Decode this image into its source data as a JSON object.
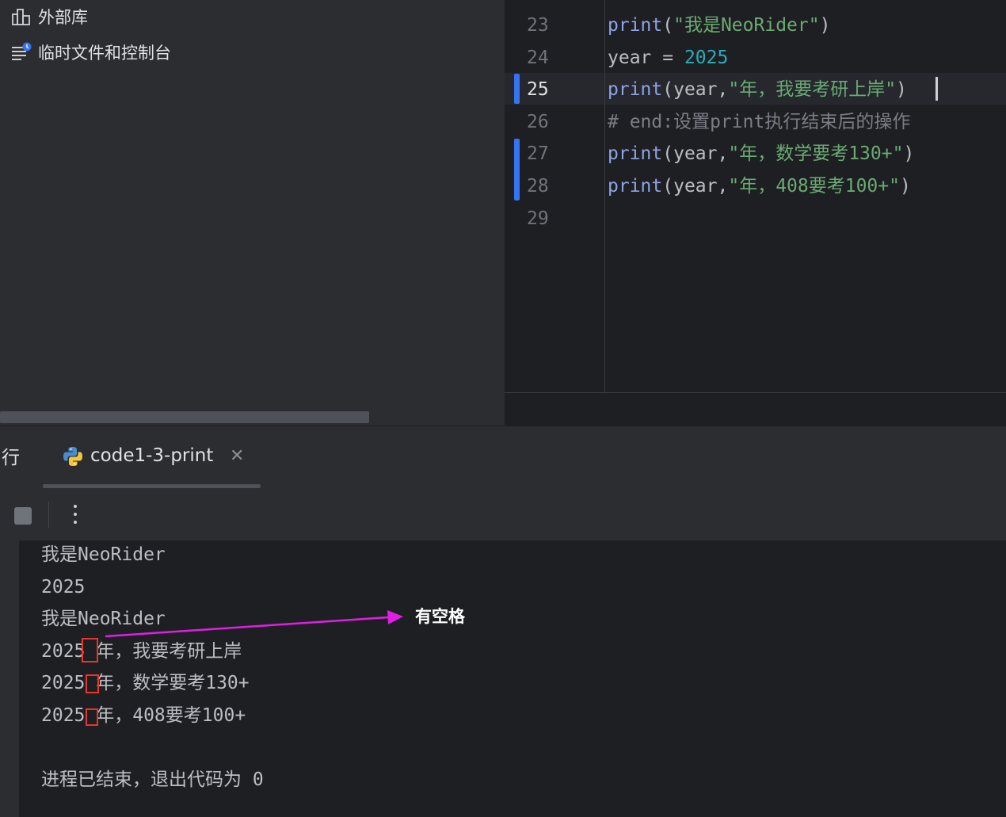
{
  "project_tree": {
    "items": [
      {
        "label": "外部库",
        "icon": "external-libraries-icon"
      },
      {
        "label": "临时文件和控制台",
        "icon": "scratches-consoles-icon"
      }
    ]
  },
  "editor": {
    "current_line": 25,
    "lines": [
      {
        "number": "23",
        "tokens": [
          [
            "fn",
            "print"
          ],
          [
            "plain",
            "("
          ],
          [
            "str",
            "\"我是NeoRider\""
          ],
          [
            "plain",
            ")"
          ]
        ]
      },
      {
        "number": "24",
        "tokens": [
          [
            "plain",
            "year = "
          ],
          [
            "num",
            "2025"
          ]
        ]
      },
      {
        "number": "25",
        "tokens": [
          [
            "fn",
            "print"
          ],
          [
            "plain",
            "(year,"
          ],
          [
            "str",
            "\"年，我要考研上岸\""
          ],
          [
            "plain",
            ")"
          ]
        ]
      },
      {
        "number": "26",
        "tokens": [
          [
            "cmt",
            "# end:设置print执行结束后的操作"
          ]
        ]
      },
      {
        "number": "27",
        "tokens": [
          [
            "fn",
            "print"
          ],
          [
            "plain",
            "(year,"
          ],
          [
            "str",
            "\"年，数学要考130+\""
          ],
          [
            "plain",
            ")"
          ]
        ]
      },
      {
        "number": "28",
        "tokens": [
          [
            "fn",
            "print"
          ],
          [
            "plain",
            "(year,"
          ],
          [
            "str",
            "\"年，408要考100+\""
          ],
          [
            "plain",
            ")"
          ]
        ]
      },
      {
        "number": "29",
        "tokens": []
      }
    ]
  },
  "run_window": {
    "title": "行",
    "tab_label": "code1-3-print",
    "close_glyph": "✕",
    "output": [
      "我是NeoRider",
      "2025",
      "我是NeoRider",
      "2025 年，我要考研上岸",
      "2025 年，数学要考130+",
      "2025 年，408要考100+",
      "",
      "进程已结束，退出代码为 0"
    ]
  },
  "annotation": {
    "text": "有空格",
    "color": "#e01fe6",
    "box_color": "#e8352e"
  },
  "colors": {
    "function": "#8fa3e6",
    "string": "#6aab73",
    "number": "#2aacb8",
    "comment": "#7a7e85",
    "change_marker": "#3574f0"
  }
}
